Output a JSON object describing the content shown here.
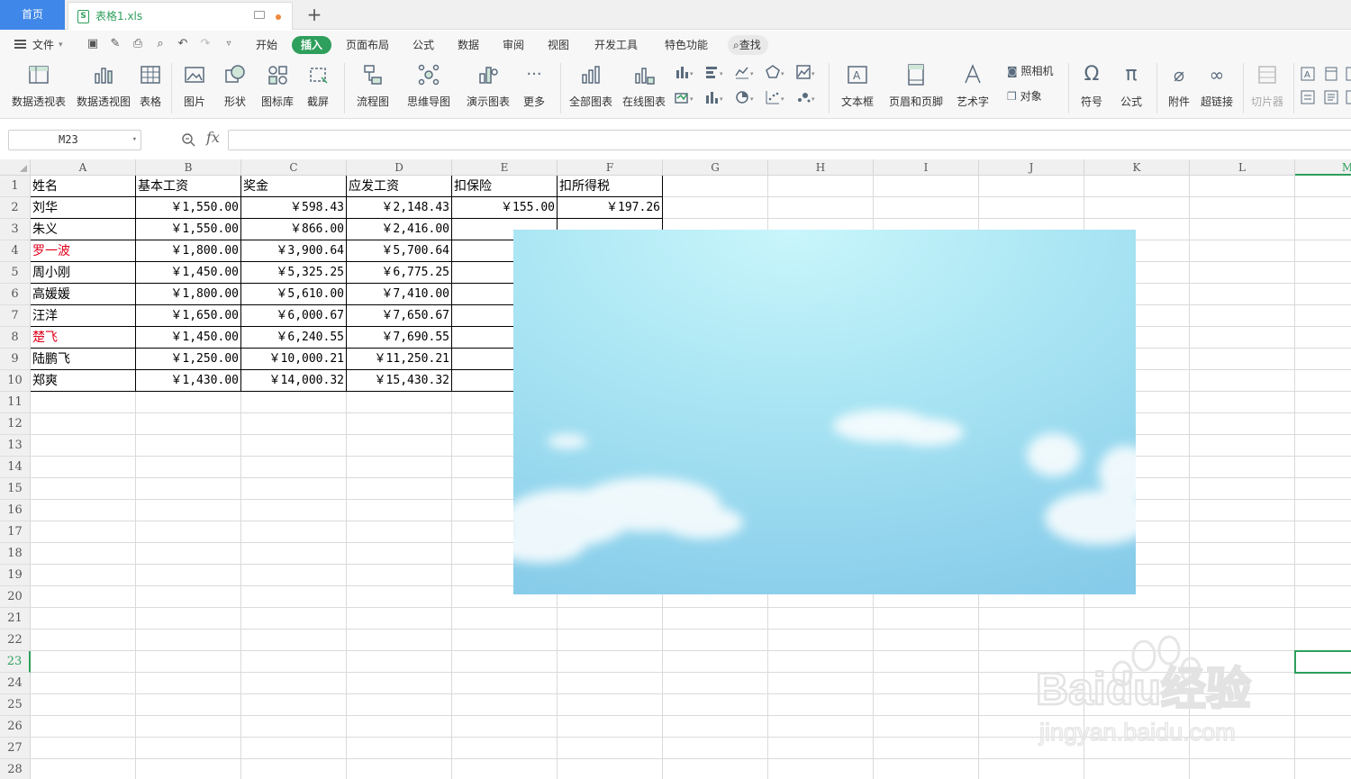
{
  "tabs": {
    "home": "首页",
    "file": "表格1.xls",
    "add": "+"
  },
  "menu": {
    "file": "文件",
    "items": [
      "开始",
      "插入",
      "页面布局",
      "公式",
      "数据",
      "审阅",
      "视图",
      "开发工具",
      "特色功能"
    ],
    "active": "插入",
    "search": "查找"
  },
  "ribbon": {
    "pivot_table": "数据透视表",
    "pivot_chart": "数据透视图",
    "table": "表格",
    "picture": "图片",
    "shape": "形状",
    "icon_lib": "图标库",
    "screenshot": "截屏",
    "flowchart": "流程图",
    "mindmap": "思维导图",
    "demo_chart": "演示图表",
    "more": "更多",
    "all_charts": "全部图表",
    "online_charts": "在线图表",
    "textbox": "文本框",
    "header_footer": "页眉和页脚",
    "wordart": "艺术字",
    "camera": "照相机",
    "object": "对象",
    "symbol": "符号",
    "formula": "公式",
    "attachment": "附件",
    "hyperlink": "超链接",
    "slicer": "切片器"
  },
  "formula_bar": {
    "cell_ref": "M23",
    "fx": "fx",
    "value": ""
  },
  "columns": [
    "A",
    "B",
    "C",
    "D",
    "E",
    "F",
    "G",
    "H",
    "I",
    "J",
    "K",
    "L",
    "M"
  ],
  "rows": [
    "1",
    "2",
    "3",
    "4",
    "5",
    "6",
    "7",
    "8",
    "9",
    "10",
    "11",
    "12",
    "13",
    "14",
    "15",
    "16",
    "17",
    "18",
    "19",
    "20",
    "21",
    "22",
    "23",
    "24",
    "25",
    "26",
    "27",
    "28"
  ],
  "headers": [
    "姓名",
    "基本工资",
    "奖金",
    "应发工资",
    "扣保险",
    "扣所得税"
  ],
  "data_rows": [
    {
      "name": "刘华",
      "red": false,
      "base": "￥1,550.00",
      "bonus": "￥598.43",
      "gross": "￥2,148.43",
      "ins": "￥155.00",
      "tax": "￥197.26"
    },
    {
      "name": "朱义",
      "red": false,
      "base": "￥1,550.00",
      "bonus": "￥866.00",
      "gross": "￥2,416.00",
      "ins": "",
      "tax": ""
    },
    {
      "name": "罗一波",
      "red": true,
      "base": "￥1,800.00",
      "bonus": "￥3,900.64",
      "gross": "￥5,700.64",
      "ins": "",
      "tax": ""
    },
    {
      "name": "周小刚",
      "red": false,
      "base": "￥1,450.00",
      "bonus": "￥5,325.25",
      "gross": "￥6,775.25",
      "ins": "",
      "tax": ""
    },
    {
      "name": "高媛媛",
      "red": false,
      "base": "￥1,800.00",
      "bonus": "￥5,610.00",
      "gross": "￥7,410.00",
      "ins": "",
      "tax": ""
    },
    {
      "name": "汪洋",
      "red": false,
      "base": "￥1,650.00",
      "bonus": "￥6,000.67",
      "gross": "￥7,650.67",
      "ins": "",
      "tax": ""
    },
    {
      "name": "楚飞",
      "red": true,
      "base": "￥1,450.00",
      "bonus": "￥6,240.55",
      "gross": "￥7,690.55",
      "ins": "",
      "tax": ""
    },
    {
      "name": "陆鹏飞",
      "red": false,
      "base": "￥1,250.00",
      "bonus": "￥10,000.21",
      "gross": "￥11,250.21",
      "ins": "",
      "tax": ""
    },
    {
      "name": "郑爽",
      "red": false,
      "base": "￥1,430.00",
      "bonus": "￥14,000.32",
      "gross": "￥15,430.32",
      "ins": "",
      "tax": ""
    }
  ],
  "selected_cell": "M23",
  "watermark": {
    "brand": "Baidu经验",
    "url": "jingyan.baidu.com"
  },
  "colors": {
    "accent": "#2e9f5c",
    "home_tab": "#3f87e8",
    "red_text": "#e0001c"
  }
}
